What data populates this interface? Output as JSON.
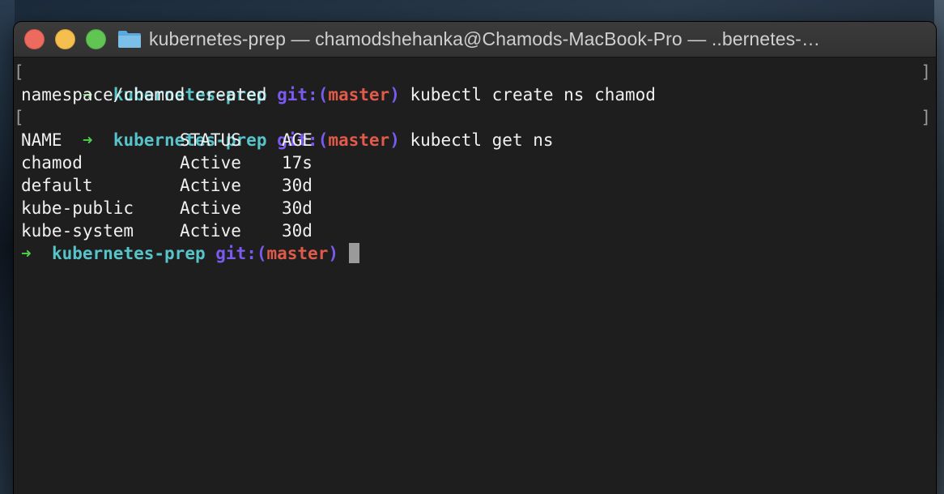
{
  "window": {
    "title": "kubernetes-prep — chamodshehanka@Chamods-MacBook-Pro — ..bernetes-…"
  },
  "icons": {
    "folder": "folder-icon"
  },
  "colors": {
    "arrow": "#4fd14a",
    "dir": "#56c4c9",
    "git": "#7a5af0",
    "branch": "#e05a4a",
    "text": "#f0f0f0",
    "background": "#1e1e1e"
  },
  "prompt": {
    "arrow": "➜",
    "dir": "kubernetes-prep",
    "git_open": "git:(",
    "branch": "master",
    "git_close": ")"
  },
  "terminal": {
    "cmd1": "kubectl create ns chamod",
    "out1": "namespace/chamod created",
    "cmd2": "kubectl get ns",
    "table": {
      "headers": [
        "NAME",
        "STATUS",
        "AGE"
      ],
      "rows": [
        [
          "chamod",
          "Active",
          "17s"
        ],
        [
          "default",
          "Active",
          "30d"
        ],
        [
          "kube-public",
          "Active",
          "30d"
        ],
        [
          "kube-system",
          "Active",
          "30d"
        ]
      ]
    }
  }
}
